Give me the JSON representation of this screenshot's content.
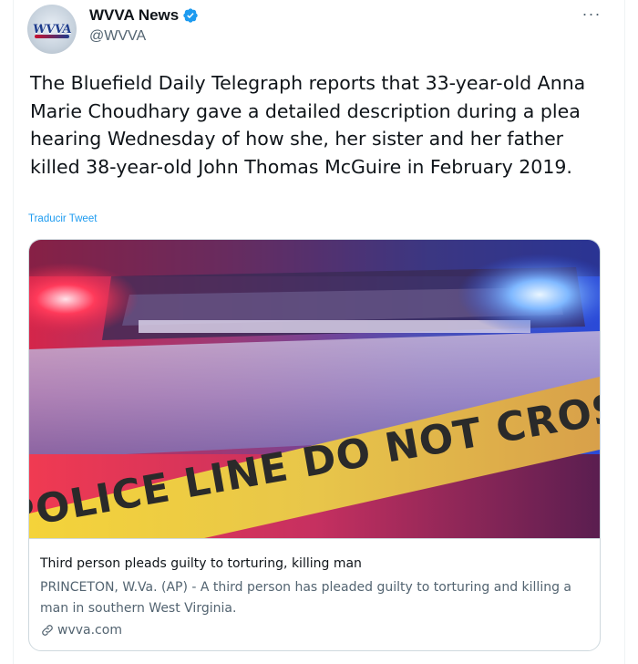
{
  "tweet": {
    "author_name": "WVVA News",
    "author_handle": "@WVVA",
    "avatar_logo_text": "WVVA",
    "more_glyph": "···",
    "text": "The Bluefield Daily Telegraph reports that 33-year-old Anna Marie Choudhary gave a detailed description during a plea hearing Wednesday of how she, her sister and her father killed 38-year-old John Thomas McGuire in February 2019.",
    "translate_label": "Traducir Tweet"
  },
  "card": {
    "image_tape_text": "POLICE LINE DO NOT CROSS",
    "title": "Third person pleads guilty to torturing, killing man",
    "description": "PRINCETON, W.Va. (AP) - A third person has pleaded guilty to torturing and killing a man in southern West Virginia.",
    "domain": "wvva.com"
  },
  "icons": {
    "verified": "verified-badge-icon",
    "more": "more-options-icon",
    "link": "link-icon"
  },
  "colors": {
    "accent": "#1d9bf0",
    "text_primary": "#0f1419",
    "text_secondary": "#536471",
    "border": "#cfd9de"
  }
}
